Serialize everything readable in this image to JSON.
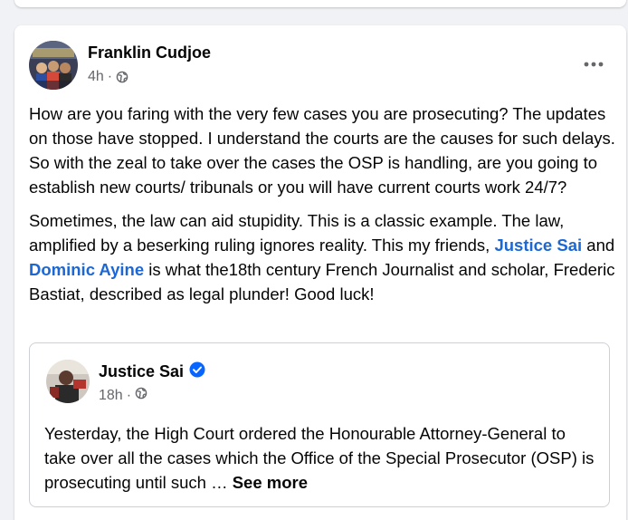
{
  "post": {
    "author": "Franklin Cudjoe",
    "time": "4h",
    "separator": "·",
    "audience_icon": "globe-icon",
    "more_icon": "more-options-icon",
    "paragraph1": "How are you faring with the very few cases you are prosecuting? The updates on those have stopped. I understand the courts are the causes for such delays.  So with the zeal to take over the cases the OSP is handling, are you going to establish new courts/ tribunals or you will have  current courts work 24/7?",
    "paragraph2": {
      "part1": "Sometimes, the law can aid stupidity.  This is a classic example.  The law, amplified by a beserking ruling ignores reality.  This my friends, ",
      "mention1": "Justice Sai",
      "part2": " and ",
      "mention2": "Dominic Ayine",
      "part3": " is what the18th century French Journalist and scholar, Frederic Bastiat, described as legal plunder! Good luck!"
    }
  },
  "shared_post": {
    "author": "Justice Sai",
    "verified_icon": "verified-badge-icon",
    "time": "18h",
    "separator": "·",
    "audience_icon": "globe-icon",
    "text": "Yesterday, the High Court ordered the Honourable Attorney-General to take over all the cases which the Office of the Special Prosecutor (OSP) is prosecuting until such … ",
    "see_more": "See more"
  },
  "colors": {
    "background": "#f0f2f5",
    "card": "#ffffff",
    "mention": "#1b67d4",
    "meta": "#65676b",
    "verified": "#0866ff"
  }
}
